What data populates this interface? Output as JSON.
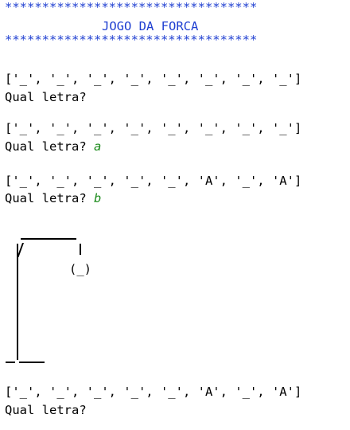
{
  "header": {
    "stars": "**********************************",
    "title": "JOGO DA FORCA"
  },
  "rounds": [
    {
      "board": "['_', '_', '_', '_', '_', '_', '_', '_']",
      "prompt": "Qual letra?",
      "input": ""
    },
    {
      "board": "['_', '_', '_', '_', '_', '_', '_', '_']",
      "prompt": "Qual letra?",
      "input": "a"
    },
    {
      "board": "['_', '_', '_', '_', '_', 'A', '_', 'A']",
      "prompt": "Qual letra?",
      "input": "b"
    }
  ],
  "hangman": {
    "head": "(_)"
  },
  "final": {
    "board": "['_', '_', '_', '_', '_', 'A', '_', 'A']",
    "prompt": "Qual letra?"
  }
}
